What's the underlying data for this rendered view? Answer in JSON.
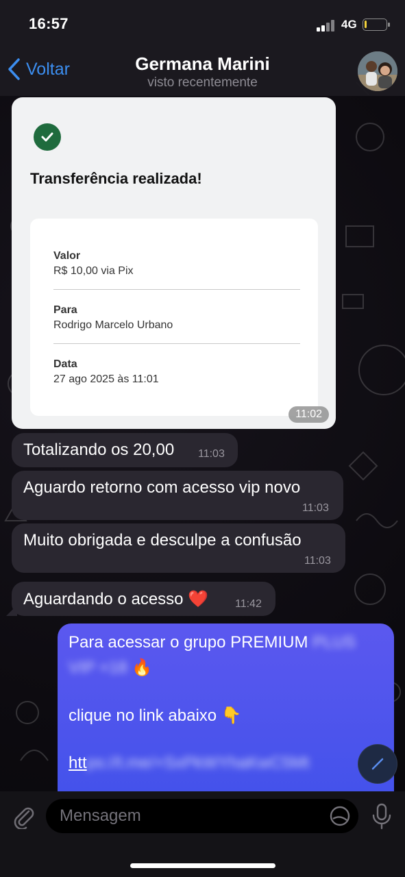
{
  "status_bar": {
    "time": "16:57",
    "network": "4G",
    "battery_level": 0.1
  },
  "header": {
    "back_label": "Voltar",
    "contact_name": "Germana Marini",
    "contact_status": "visto recentemente"
  },
  "receipt": {
    "title": "Transferência realizada!",
    "fields": [
      {
        "label": "Valor",
        "value": "R$ 10,00 via Pix"
      },
      {
        "label": "Para",
        "value": "Rodrigo Marcelo Urbano"
      },
      {
        "label": "Data",
        "value": "27 ago 2025 às 11:01"
      }
    ],
    "time": "11:02"
  },
  "messages": [
    {
      "text": "Totalizando os 20,00",
      "time": "11:03"
    },
    {
      "text": "Aguardo retorno com acesso vip novo",
      "time": "11:03"
    },
    {
      "text": "Muito obrigada e desculpe a confusão",
      "time": "11:03"
    },
    {
      "text": "Aguardando o acesso ❤️",
      "time": "11:42"
    }
  ],
  "outgoing": {
    "line1": "Para acessar o grupo PREMIUM",
    "line1_blurred": "PLUS",
    "line2_blurred": "VIP +18",
    "line2_emoji": "🔥",
    "line3": "clique no link abaixo 👇",
    "link_prefix": "htt",
    "link_blurred": "ps://t.me/+SxPkWYhaKwC5Mt"
  },
  "input": {
    "placeholder": "Mensagem"
  },
  "colors": {
    "accent": "#3c8ef0",
    "outgoing_bubble": "#4a55ee",
    "incoming_bubble": "#2a2730",
    "success": "#1f6b3d"
  }
}
